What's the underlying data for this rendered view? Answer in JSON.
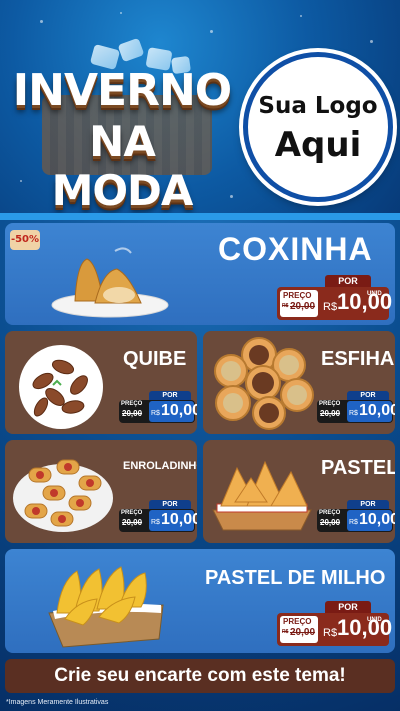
{
  "header": {
    "title_line1": "INVERNO",
    "title_line2": "NA MODA",
    "logo_line1": "Sua Logo",
    "logo_line2": "Aqui"
  },
  "colors": {
    "background": "#0a4c8e",
    "card_blue": "#3d84d2",
    "card_brown": "#6b4a3a",
    "price_red": "#8a2a1c",
    "price_blue": "#1f63c4",
    "cta": "#5a2f22"
  },
  "discount_badge": "-50%",
  "tag_labels": {
    "por": "POR",
    "preco": "PREÇO",
    "currency": "R$",
    "unit": "UNID"
  },
  "products": {
    "coxinha": {
      "name": "COXINHA",
      "old_price": "20,00",
      "price": "10,00",
      "old_prefix": "R$",
      "image": "coxinha-icon"
    },
    "quibe": {
      "name": "QUIBE",
      "old_price": "20,00",
      "price": "10,00",
      "image": "quibe-icon"
    },
    "esfiha": {
      "name": "ESFIHA",
      "old_price": "20,00",
      "price": "10,00",
      "image": "esfiha-icon"
    },
    "enroladinho": {
      "name": "ENROLADINHO",
      "old_price": "20,00",
      "price": "10,00",
      "image": "enroladinho-icon"
    },
    "pastel": {
      "name": "PASTEL",
      "old_price": "20,00",
      "price": "10,00",
      "image": "pastel-icon"
    },
    "pastel_milho": {
      "name": "PASTEL DE MILHO",
      "old_price": "20,00",
      "price": "10,00",
      "old_prefix": "R$",
      "image": "pastel-milho-icon"
    }
  },
  "cta": "Crie seu encarte com este tema!",
  "disclaimer": "*Imagens Meramente Ilustrativas"
}
